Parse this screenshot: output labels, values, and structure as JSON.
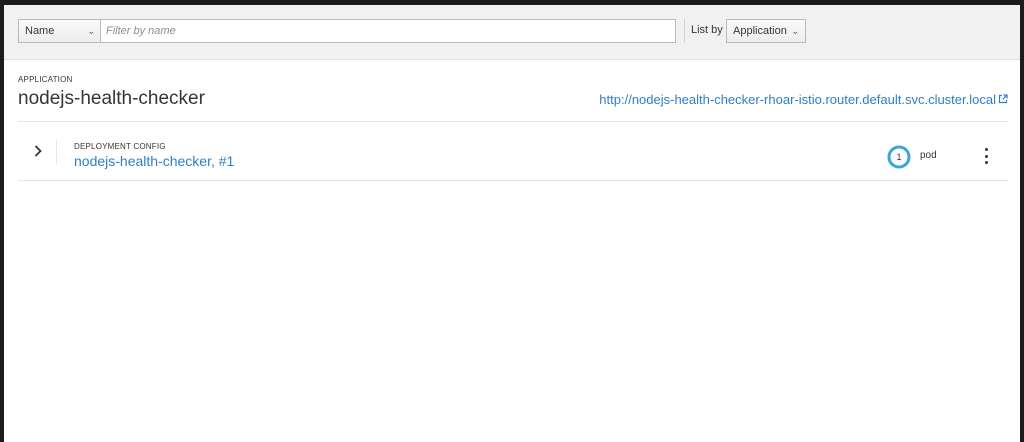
{
  "toolbar": {
    "filter_select_value": "Name",
    "filter_placeholder": "Filter by name",
    "list_by_label": "List by",
    "list_by_value": "Application"
  },
  "application": {
    "caption": "APPLICATION",
    "name": "nodejs-health-checker",
    "route_url": "http://nodejs-health-checker-rhoar-istio.router.default.svc.cluster.local"
  },
  "deployment": {
    "caption": "DEPLOYMENT CONFIG",
    "name": "nodejs-health-checker",
    "separator": ",",
    "version": "#1",
    "pod_count": "1",
    "pod_label": "pod",
    "status_color": "#39a5dc"
  },
  "icons": {
    "expand": "chevron-right-icon",
    "external_link": "external-link-icon",
    "menu": "kebab-menu-icon",
    "dropdown": "chevron-down-icon"
  }
}
